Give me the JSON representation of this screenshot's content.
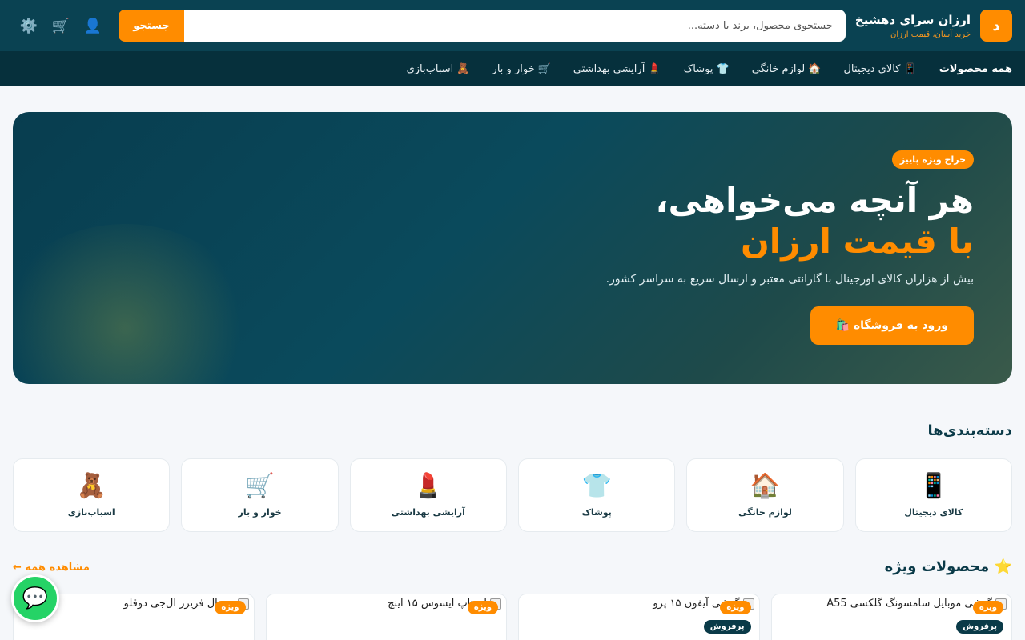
{
  "header": {
    "logo_letter": "د",
    "brand_title": "ارزان سرای دهشیخ",
    "brand_subtitle": "خرید آسان، قیمت ارزان",
    "search_placeholder": "جستجوی محصول، برند یا دسته...",
    "search_button": "جستجو",
    "icons": [
      "user-icon",
      "cart-icon",
      "gear-icon"
    ],
    "icon_glyphs": {
      "user": "👤",
      "cart": "🛒",
      "gear": "⚙️"
    }
  },
  "nav": {
    "items": [
      {
        "label": "همه محصولات"
      },
      {
        "label": "📱 کالای دیجیتال"
      },
      {
        "label": "🏠 لوازم خانگی"
      },
      {
        "label": "👕 پوشاک"
      },
      {
        "label": "💄 آرایشی بهداشتی"
      },
      {
        "label": "🛒 خوار و بار"
      },
      {
        "label": "🧸 اسباب‌بازی"
      }
    ]
  },
  "hero": {
    "badge": "حراج ویژه پاییز",
    "title_line1": "هر آنچه می‌خواهی،",
    "title_line2": "با قیمت ارزان",
    "description": "بیش از هزاران کالای اورجینال با گارانتی معتبر و ارسال سریع به سراسر کشور.",
    "cta": "ورود به فروشگاه 🛍️"
  },
  "categories": {
    "title": "دسته‌بندی‌ها",
    "items": [
      {
        "icon": "📱",
        "label": "کالای دیجیتال"
      },
      {
        "icon": "🏠",
        "label": "لوازم خانگی"
      },
      {
        "icon": "👕",
        "label": "پوشاک"
      },
      {
        "icon": "💄",
        "label": "آرایشی بهداشتی"
      },
      {
        "icon": "🛒",
        "label": "خوار و بار"
      },
      {
        "icon": "🧸",
        "label": "اسباب‌بازی"
      }
    ]
  },
  "featured": {
    "title": "⭐ محصولات ویژه",
    "see_all": "مشاهده همه ←",
    "products": [
      {
        "name": "گوشی موبایل سامسونگ گلکسی A55",
        "tag_special": "ویژه",
        "tag_best": "پرفروش"
      },
      {
        "name": "گوشی آیفون ۱۵ پرو",
        "tag_special": "ویژه",
        "tag_best": "پرفروش"
      },
      {
        "name": "لپ‌تاپ ایسوس ۱۵ اینچ",
        "tag_special": "ویژه",
        "tag_best": ""
      },
      {
        "name": "یخچال فریزر ال‌جی دوقلو",
        "tag_special": "ویژه",
        "tag_best": ""
      }
    ]
  },
  "chat": {
    "icon": "💬"
  },
  "colors": {
    "primary": "#0a4252",
    "accent": "#ff8c00",
    "nav": "#06303c"
  }
}
